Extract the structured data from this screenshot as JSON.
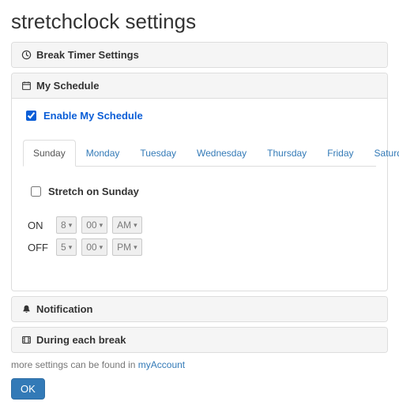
{
  "page_title": "stretchclock settings",
  "sections": {
    "break_timer": {
      "label": "Break Timer Settings"
    },
    "my_schedule": {
      "label": "My Schedule",
      "enable_label": "Enable My Schedule",
      "enable_checked": true,
      "tabs": [
        "Sunday",
        "Monday",
        "Tuesday",
        "Wednesday",
        "Thursday",
        "Friday",
        "Saturday"
      ],
      "active_tab": "Sunday",
      "stretch_on_label": "Stretch on Sunday",
      "stretch_on_checked": false,
      "on_label": "ON",
      "off_label": "OFF",
      "on": {
        "hour": "8",
        "minute": "00",
        "ampm": "AM"
      },
      "off": {
        "hour": "5",
        "minute": "00",
        "ampm": "PM"
      }
    },
    "notification": {
      "label": "Notification"
    },
    "during_break": {
      "label": "During each break"
    }
  },
  "footer": {
    "prefix": "more settings can be found in ",
    "link": "myAccount"
  },
  "ok_button": "OK"
}
